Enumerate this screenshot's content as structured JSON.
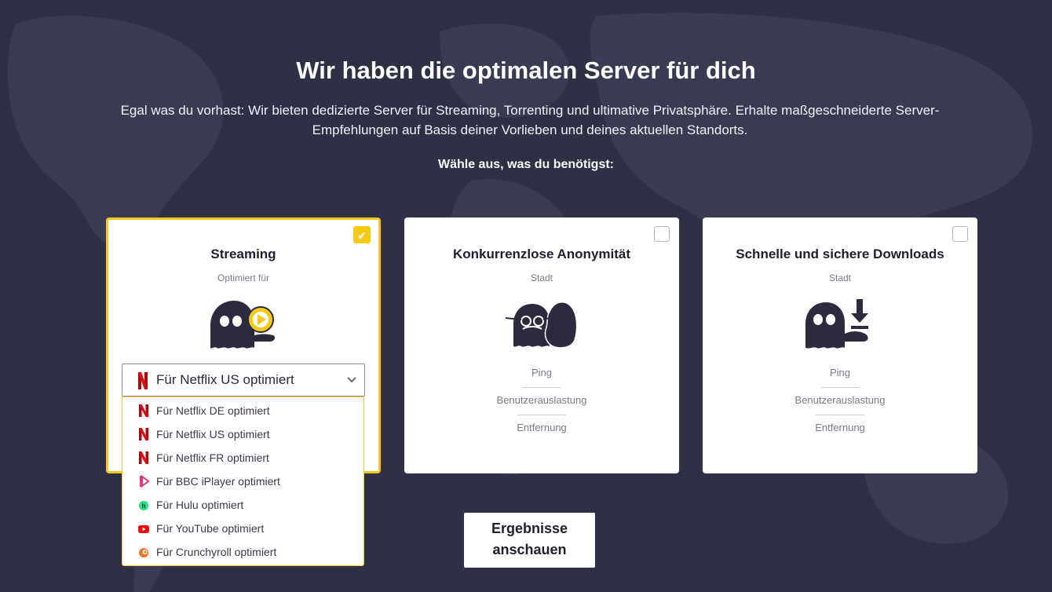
{
  "headline": "Wir haben die optimalen Server für dich",
  "subtext": "Egal was du vorhast: Wir bieten dedizierte Server für Streaming, Torrenting und ultimative Privatsphäre. Erhalte maßgeschneiderte Server-Empfehlungen auf Basis deiner Vorlieben und deines aktuellen Standorts.",
  "choose_prompt": "Wähle aus, was du benötigst:",
  "colors": {
    "accent": "#f6c915",
    "background": "#2f2f46",
    "ghost": "#2b2b3d",
    "netflix": "#e50914"
  },
  "cards": {
    "streaming": {
      "title": "Streaming",
      "subtitle": "Optimiert für",
      "checked": true,
      "icon": "ghost-play-icon"
    },
    "anonymity": {
      "title": "Konkurrenzlose Anonymität",
      "subtitle": "Stadt",
      "checked": false,
      "icon": "ghost-disguise-icon",
      "stats": [
        "Ping",
        "Benutzerauslastung",
        "Entfernung"
      ]
    },
    "downloads": {
      "title": "Schnelle und sichere Downloads",
      "subtitle": "Stadt",
      "checked": false,
      "icon": "ghost-download-icon",
      "stats": [
        "Ping",
        "Benutzerauslastung",
        "Entfernung"
      ]
    }
  },
  "select": {
    "selected": "Für Netflix US optimiert",
    "icon": "netflix-icon"
  },
  "dropdown_options": [
    {
      "label": "Für Netflix DE optimiert",
      "icon": "netflix-icon"
    },
    {
      "label": "Für Netflix US optimiert",
      "icon": "netflix-icon"
    },
    {
      "label": "Für Netflix FR optimiert",
      "icon": "netflix-icon"
    },
    {
      "label": "Für BBC iPlayer optimiert",
      "icon": "bbc-iplayer-icon"
    },
    {
      "label": "Für Hulu optimiert",
      "icon": "hulu-icon"
    },
    {
      "label": "Für YouTube optimiert",
      "icon": "youtube-icon"
    },
    {
      "label": "Für Crunchyroll optimiert",
      "icon": "crunchyroll-icon"
    }
  ],
  "results_button": {
    "line1": "Ergebnisse",
    "line2": "anschauen"
  }
}
